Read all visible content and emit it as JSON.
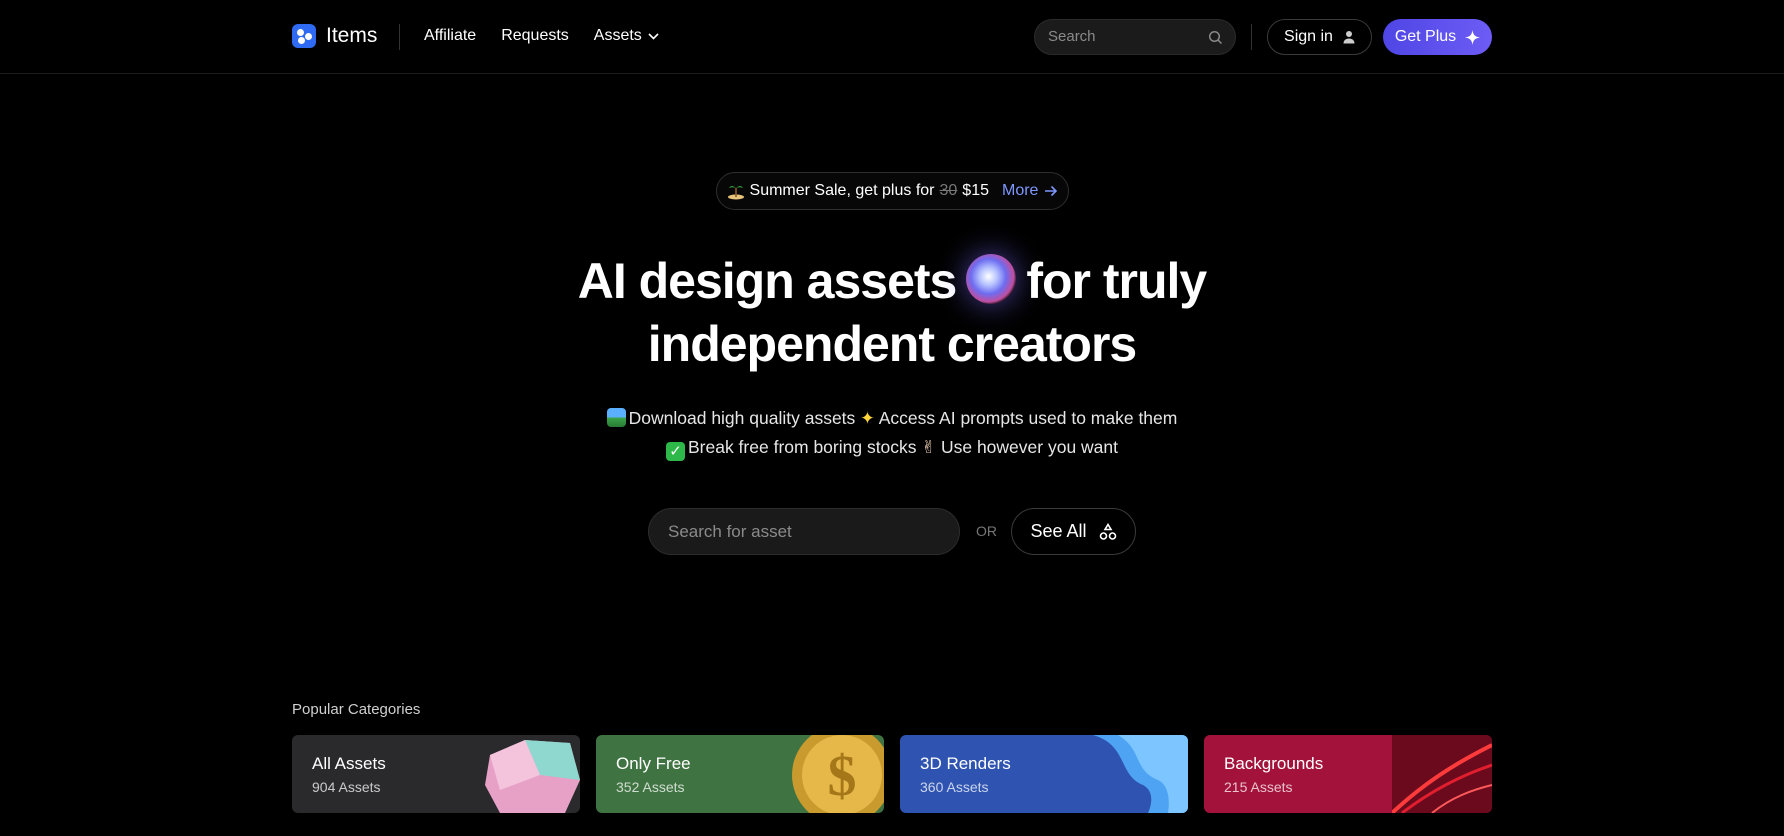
{
  "header": {
    "logo_text": "Items",
    "nav": [
      "Affiliate",
      "Requests",
      "Assets"
    ],
    "search_placeholder": "Search",
    "signin_label": "Sign in",
    "getplus_label": "Get Plus",
    "accent_color": "#4f46e5"
  },
  "promo": {
    "icon": "island-emoji",
    "text": "Summer Sale, get plus for",
    "old_price": "30",
    "new_price": "$15",
    "more_label": "More"
  },
  "hero": {
    "title_line1_a": "AI design assets",
    "title_line1_b": "for truly",
    "title_line2": "independent creators",
    "sub_line1_a": "Download high quality assets",
    "sub_line1_b": "Access AI prompts used to make them",
    "sub_line2_a": "Break free from boring stocks",
    "sub_line2_b": "Use however you want"
  },
  "search": {
    "placeholder": "Search for asset",
    "or_label": "OR",
    "see_all_label": "See All"
  },
  "categories": {
    "heading": "Popular Categories",
    "items": [
      {
        "title": "All Assets",
        "count": "904 Assets",
        "color": "#2a2a2c"
      },
      {
        "title": "Only Free",
        "count": "352 Assets",
        "color": "#3f7442"
      },
      {
        "title": "3D Renders",
        "count": "360 Assets",
        "color": "#2e53b0"
      },
      {
        "title": "Backgrounds",
        "count": "215 Assets",
        "color": "#a3123a"
      }
    ]
  }
}
